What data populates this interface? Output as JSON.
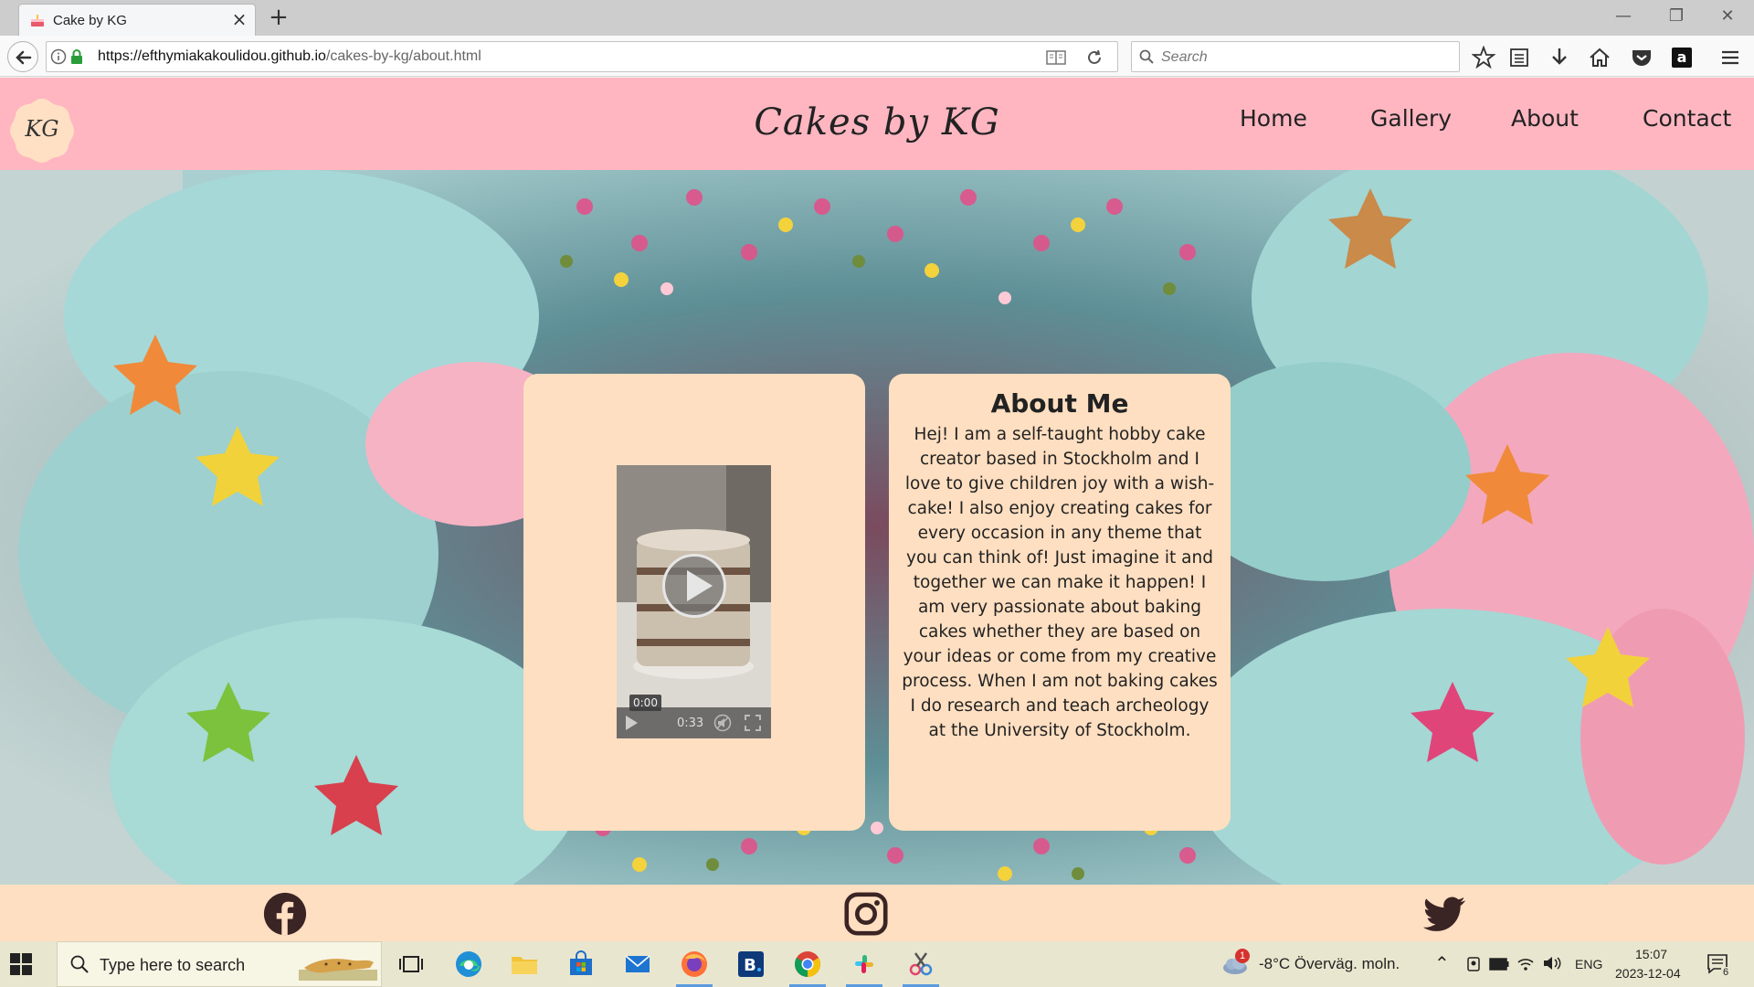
{
  "browser": {
    "tab_title": "Cake by KG",
    "url_domain": "https://efthymiakakoulidou.github.io",
    "url_path": "/cakes-by-kg/about.html",
    "search_placeholder": "Search"
  },
  "site": {
    "logo": "KG",
    "title": "Cakes by KG",
    "nav": [
      "Home",
      "Gallery",
      "About",
      "Contact"
    ]
  },
  "video": {
    "current_time": "0:00",
    "duration": "0:33"
  },
  "about": {
    "title": "About Me",
    "text": "Hej! I am a self-taught hobby cake creator based in Stockholm and I love to give children joy with a wish-cake! I also enjoy creating cakes for every occasion in any theme that you can think of! Just imagine it and together we can make it happen! I am very passionate about baking cakes whether they are based on your ideas or come from my creative process. When I am not baking cakes I do research and teach archeology at the University of Stockholm."
  },
  "footer": {
    "icons": [
      "facebook-icon",
      "instagram-icon",
      "twitter-icon"
    ]
  },
  "taskbar": {
    "search_placeholder": "Type here to search",
    "weather_badge": "1",
    "weather": "-8°C  Överväg. moln.",
    "language": "ENG",
    "time": "15:07",
    "date": "2023-12-04",
    "notifications": "6"
  },
  "colors": {
    "header_pink": "#ffb6c1",
    "card_peach": "#ffdfc1",
    "footer_peach": "#ffdfc1"
  }
}
